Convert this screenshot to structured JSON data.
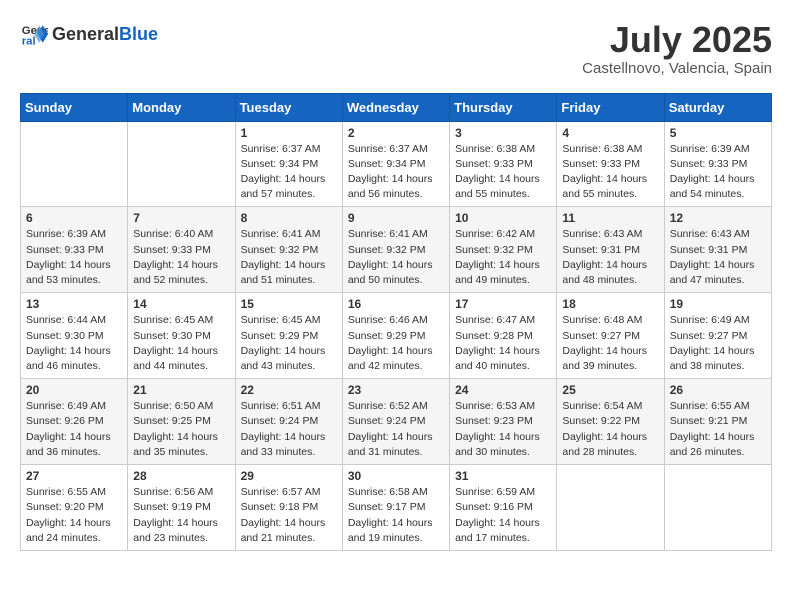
{
  "header": {
    "logo_general": "General",
    "logo_blue": "Blue",
    "month_title": "July 2025",
    "location": "Castellnovo, Valencia, Spain"
  },
  "weekdays": [
    "Sunday",
    "Monday",
    "Tuesday",
    "Wednesday",
    "Thursday",
    "Friday",
    "Saturday"
  ],
  "weeks": [
    [
      {
        "day": "",
        "sunrise": "",
        "sunset": "",
        "daylight": "",
        "empty": true
      },
      {
        "day": "",
        "sunrise": "",
        "sunset": "",
        "daylight": "",
        "empty": true
      },
      {
        "day": "1",
        "sunrise": "Sunrise: 6:37 AM",
        "sunset": "Sunset: 9:34 PM",
        "daylight": "Daylight: 14 hours and 57 minutes."
      },
      {
        "day": "2",
        "sunrise": "Sunrise: 6:37 AM",
        "sunset": "Sunset: 9:34 PM",
        "daylight": "Daylight: 14 hours and 56 minutes."
      },
      {
        "day": "3",
        "sunrise": "Sunrise: 6:38 AM",
        "sunset": "Sunset: 9:33 PM",
        "daylight": "Daylight: 14 hours and 55 minutes."
      },
      {
        "day": "4",
        "sunrise": "Sunrise: 6:38 AM",
        "sunset": "Sunset: 9:33 PM",
        "daylight": "Daylight: 14 hours and 55 minutes."
      },
      {
        "day": "5",
        "sunrise": "Sunrise: 6:39 AM",
        "sunset": "Sunset: 9:33 PM",
        "daylight": "Daylight: 14 hours and 54 minutes."
      }
    ],
    [
      {
        "day": "6",
        "sunrise": "Sunrise: 6:39 AM",
        "sunset": "Sunset: 9:33 PM",
        "daylight": "Daylight: 14 hours and 53 minutes."
      },
      {
        "day": "7",
        "sunrise": "Sunrise: 6:40 AM",
        "sunset": "Sunset: 9:33 PM",
        "daylight": "Daylight: 14 hours and 52 minutes."
      },
      {
        "day": "8",
        "sunrise": "Sunrise: 6:41 AM",
        "sunset": "Sunset: 9:32 PM",
        "daylight": "Daylight: 14 hours and 51 minutes."
      },
      {
        "day": "9",
        "sunrise": "Sunrise: 6:41 AM",
        "sunset": "Sunset: 9:32 PM",
        "daylight": "Daylight: 14 hours and 50 minutes."
      },
      {
        "day": "10",
        "sunrise": "Sunrise: 6:42 AM",
        "sunset": "Sunset: 9:32 PM",
        "daylight": "Daylight: 14 hours and 49 minutes."
      },
      {
        "day": "11",
        "sunrise": "Sunrise: 6:43 AM",
        "sunset": "Sunset: 9:31 PM",
        "daylight": "Daylight: 14 hours and 48 minutes."
      },
      {
        "day": "12",
        "sunrise": "Sunrise: 6:43 AM",
        "sunset": "Sunset: 9:31 PM",
        "daylight": "Daylight: 14 hours and 47 minutes."
      }
    ],
    [
      {
        "day": "13",
        "sunrise": "Sunrise: 6:44 AM",
        "sunset": "Sunset: 9:30 PM",
        "daylight": "Daylight: 14 hours and 46 minutes."
      },
      {
        "day": "14",
        "sunrise": "Sunrise: 6:45 AM",
        "sunset": "Sunset: 9:30 PM",
        "daylight": "Daylight: 14 hours and 44 minutes."
      },
      {
        "day": "15",
        "sunrise": "Sunrise: 6:45 AM",
        "sunset": "Sunset: 9:29 PM",
        "daylight": "Daylight: 14 hours and 43 minutes."
      },
      {
        "day": "16",
        "sunrise": "Sunrise: 6:46 AM",
        "sunset": "Sunset: 9:29 PM",
        "daylight": "Daylight: 14 hours and 42 minutes."
      },
      {
        "day": "17",
        "sunrise": "Sunrise: 6:47 AM",
        "sunset": "Sunset: 9:28 PM",
        "daylight": "Daylight: 14 hours and 40 minutes."
      },
      {
        "day": "18",
        "sunrise": "Sunrise: 6:48 AM",
        "sunset": "Sunset: 9:27 PM",
        "daylight": "Daylight: 14 hours and 39 minutes."
      },
      {
        "day": "19",
        "sunrise": "Sunrise: 6:49 AM",
        "sunset": "Sunset: 9:27 PM",
        "daylight": "Daylight: 14 hours and 38 minutes."
      }
    ],
    [
      {
        "day": "20",
        "sunrise": "Sunrise: 6:49 AM",
        "sunset": "Sunset: 9:26 PM",
        "daylight": "Daylight: 14 hours and 36 minutes."
      },
      {
        "day": "21",
        "sunrise": "Sunrise: 6:50 AM",
        "sunset": "Sunset: 9:25 PM",
        "daylight": "Daylight: 14 hours and 35 minutes."
      },
      {
        "day": "22",
        "sunrise": "Sunrise: 6:51 AM",
        "sunset": "Sunset: 9:24 PM",
        "daylight": "Daylight: 14 hours and 33 minutes."
      },
      {
        "day": "23",
        "sunrise": "Sunrise: 6:52 AM",
        "sunset": "Sunset: 9:24 PM",
        "daylight": "Daylight: 14 hours and 31 minutes."
      },
      {
        "day": "24",
        "sunrise": "Sunrise: 6:53 AM",
        "sunset": "Sunset: 9:23 PM",
        "daylight": "Daylight: 14 hours and 30 minutes."
      },
      {
        "day": "25",
        "sunrise": "Sunrise: 6:54 AM",
        "sunset": "Sunset: 9:22 PM",
        "daylight": "Daylight: 14 hours and 28 minutes."
      },
      {
        "day": "26",
        "sunrise": "Sunrise: 6:55 AM",
        "sunset": "Sunset: 9:21 PM",
        "daylight": "Daylight: 14 hours and 26 minutes."
      }
    ],
    [
      {
        "day": "27",
        "sunrise": "Sunrise: 6:55 AM",
        "sunset": "Sunset: 9:20 PM",
        "daylight": "Daylight: 14 hours and 24 minutes."
      },
      {
        "day": "28",
        "sunrise": "Sunrise: 6:56 AM",
        "sunset": "Sunset: 9:19 PM",
        "daylight": "Daylight: 14 hours and 23 minutes."
      },
      {
        "day": "29",
        "sunrise": "Sunrise: 6:57 AM",
        "sunset": "Sunset: 9:18 PM",
        "daylight": "Daylight: 14 hours and 21 minutes."
      },
      {
        "day": "30",
        "sunrise": "Sunrise: 6:58 AM",
        "sunset": "Sunset: 9:17 PM",
        "daylight": "Daylight: 14 hours and 19 minutes."
      },
      {
        "day": "31",
        "sunrise": "Sunrise: 6:59 AM",
        "sunset": "Sunset: 9:16 PM",
        "daylight": "Daylight: 14 hours and 17 minutes."
      },
      {
        "day": "",
        "sunrise": "",
        "sunset": "",
        "daylight": "",
        "empty": true
      },
      {
        "day": "",
        "sunrise": "",
        "sunset": "",
        "daylight": "",
        "empty": true
      }
    ]
  ]
}
